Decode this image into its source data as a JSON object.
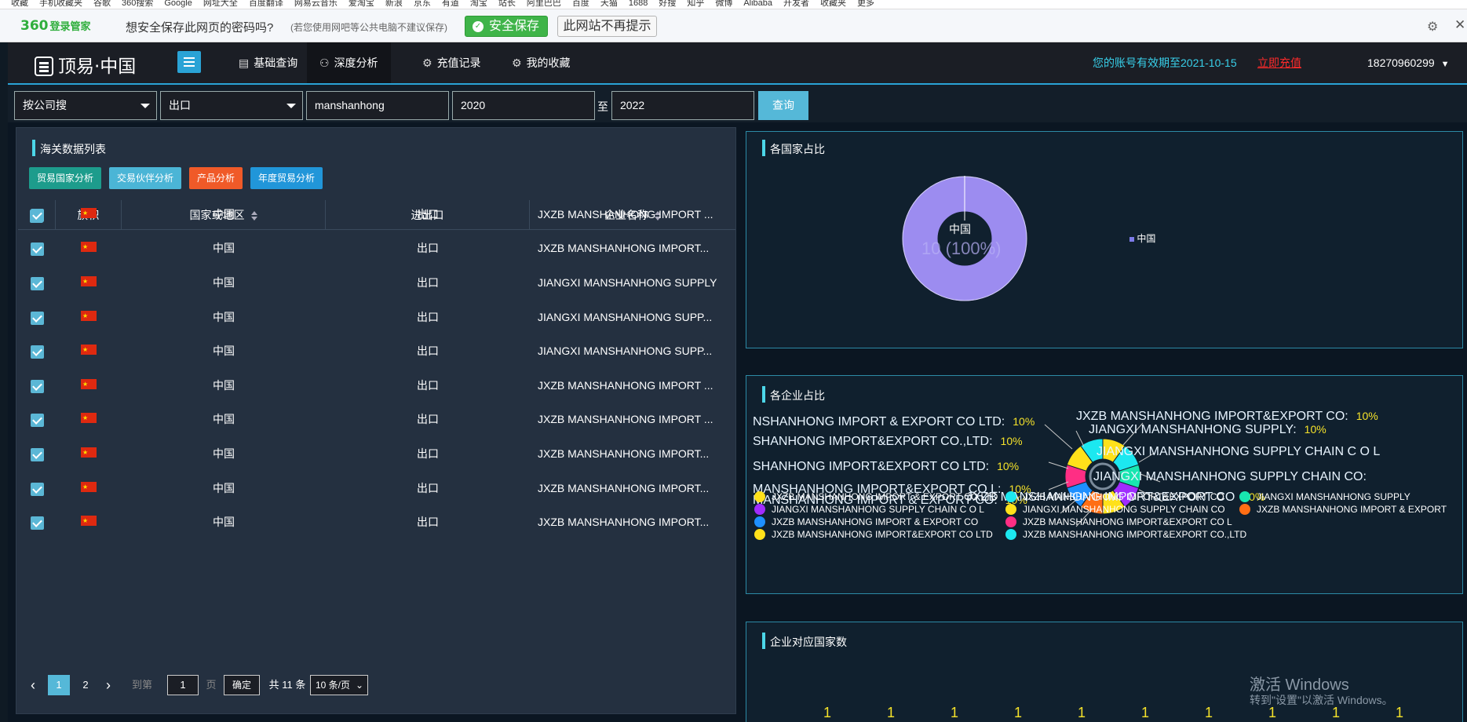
{
  "browser": {
    "bookmarks": [
      "收藏",
      "手机收藏夹",
      "谷歌",
      "360搜索",
      "Google",
      "网址大全",
      "百度翻译",
      "网易云音乐",
      "爱淘宝",
      "新浪",
      "京东",
      "有道",
      "淘宝",
      "站长",
      "阿里巴巴",
      "百度",
      "天猫",
      "1688",
      "好搜",
      "知乎",
      "微博",
      "Alibaba",
      "开发者",
      "收藏夹",
      "更多"
    ],
    "password_prompt": {
      "logo": "360",
      "logo_sub": "登录管家",
      "question": "想安全保存此网页的密码吗?",
      "note": "(若您使用网吧等公共电脑不建议保存)",
      "save_label": "安全保存",
      "never_label": "此网站不再提示"
    }
  },
  "nav": {
    "brand": "顶易·中国",
    "tabs": [
      {
        "label": "基础查询",
        "icon": "document-icon"
      },
      {
        "label": "深度分析",
        "icon": "users-icon"
      },
      {
        "label": "充值记录",
        "icon": "gear-icon"
      },
      {
        "label": "我的收藏",
        "icon": "gear-icon"
      }
    ],
    "account_notice": "您的账号有效期至2021-10-15",
    "recharge": "立即充值",
    "user": "18270960299"
  },
  "search": {
    "mode": "按公司搜",
    "direction": "出口",
    "keyword": "manshanhong",
    "year_from": "2020",
    "to_label": "至",
    "year_to": "2022",
    "query_label": "查询"
  },
  "left": {
    "title": "海关数据列表",
    "actions": [
      {
        "label": "贸易国家分析",
        "color": "#1d9c8c"
      },
      {
        "label": "交易伙伴分析",
        "color": "#4bb5d6"
      },
      {
        "label": "产品分析",
        "color": "#f05a28"
      },
      {
        "label": "年度贸易分析",
        "color": "#2196d9"
      }
    ],
    "columns": [
      "旗帜",
      "国家或地区",
      "进出口",
      "企业名称"
    ],
    "rows": [
      {
        "country": "中国",
        "direction": "出口",
        "company": "JXZB MANSHANHONG IMPORT ..."
      },
      {
        "country": "中国",
        "direction": "出口",
        "company": "JXZB MANSHANHONG IMPORT..."
      },
      {
        "country": "中国",
        "direction": "出口",
        "company": "JIANGXI MANSHANHONG SUPPLY"
      },
      {
        "country": "中国",
        "direction": "出口",
        "company": "JIANGXI MANSHANHONG SUPP..."
      },
      {
        "country": "中国",
        "direction": "出口",
        "company": "JIANGXI MANSHANHONG SUPP..."
      },
      {
        "country": "中国",
        "direction": "出口",
        "company": "JXZB MANSHANHONG IMPORT ..."
      },
      {
        "country": "中国",
        "direction": "出口",
        "company": "JXZB MANSHANHONG IMPORT ..."
      },
      {
        "country": "中国",
        "direction": "出口",
        "company": "JXZB MANSHANHONG IMPORT..."
      },
      {
        "country": "中国",
        "direction": "出口",
        "company": "JXZB MANSHANHONG IMPORT..."
      },
      {
        "country": "中国",
        "direction": "出口",
        "company": "JXZB MANSHANHONG IMPORT..."
      }
    ],
    "pager": {
      "page1": "1",
      "page2": "2",
      "goto": "到第",
      "goto_value": "1",
      "page_unit": "页",
      "confirm": "确定",
      "total": "共 11 条",
      "per_page": "10 条/页"
    }
  },
  "country_panel": {
    "title": "各国家占比",
    "center_label": "中国",
    "center_value": "10 (100%)",
    "legend": "中国",
    "color": "#9c8cf0"
  },
  "company_panel": {
    "title": "各企业占比",
    "labels": [
      {
        "name": "NSHANHONG IMPORT & EXPORT CO LTD:",
        "pct": "10%"
      },
      {
        "name": "JXZB MANSHANHONG IMPORT&EXPORT CO:",
        "pct": "10%"
      },
      {
        "name": "JIANGXI MANSHANHONG SUPPLY:",
        "pct": "10%"
      },
      {
        "name": "SHANHONG IMPORT&EXPORT CO.,LTD:",
        "pct": "10%"
      },
      {
        "name": "JIANGXI MANSHANHONG SUPPLY CHAIN C O L",
        "pct": ""
      },
      {
        "name": "SHANHONG IMPORT&EXPORT CO LTD:",
        "pct": "10%"
      },
      {
        "name": "JIANGXI MANSHANHONG SUPPLY CHAIN CO:",
        "pct": ""
      },
      {
        "name": "MANSHANHONG IMPORT&EXPORT CO L:",
        "pct": "10%"
      },
      {
        "name": "MANSHANHONG IMPORT & EXPORT CO:",
        "pct": "10%"
      },
      {
        "name": "JXZB MANSHANHONG IMPORT&EXPORT CO",
        "pct": "10%"
      }
    ],
    "legend": [
      {
        "name": "JXZB MANSHANHONG IMPORT & EXPORT CO LTD",
        "color": "#ffe11a"
      },
      {
        "name": "JXZB MANSHANHONG IMPORT&EXPORT CO",
        "color": "#1ce8f0"
      },
      {
        "name": "JIANGXI MANSHANHONG SUPPLY",
        "color": "#18e6b0"
      },
      {
        "name": "JIANGXI MANSHANHONG SUPPLY CHAIN C O L",
        "color": "#a12cff"
      },
      {
        "name": "JIANGXI MANSHANHONG SUPPLY CHAIN CO",
        "color": "#ffe11a"
      },
      {
        "name": "JXZB MANSHANHONG IMPORT & EXPORT",
        "color": "#ff6e14"
      },
      {
        "name": "JXZB MANSHANHONG IMPORT & EXPORT CO",
        "color": "#1e90ff"
      },
      {
        "name": "JXZB MANSHANHONG IMPORT&EXPORT CO L",
        "color": "#ff2e84"
      },
      {
        "name": "JXZB MANSHANHONG IMPORT&EXPORT CO LTD",
        "color": "#ffe11a"
      },
      {
        "name": "JXZB MANSHANHONG IMPORT&EXPORT CO.,LTD",
        "color": "#1ce8f0"
      }
    ]
  },
  "bar_panel": {
    "title": "企业对应国家数",
    "values": [
      "1",
      "1",
      "1",
      "1",
      "1",
      "1",
      "1",
      "1",
      "1",
      "1"
    ]
  },
  "watermark": {
    "line1": "激活 Windows",
    "line2": "转到\"设置\"以激活 Windows。"
  }
}
